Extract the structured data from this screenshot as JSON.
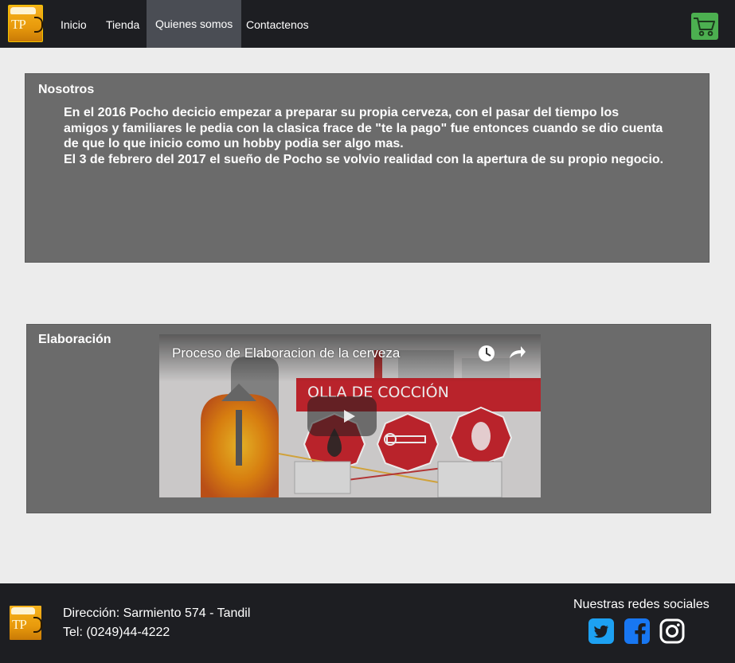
{
  "nav": {
    "logo_text": "TP",
    "items": [
      "Inicio",
      "Tienda",
      "Quienes somos",
      "Contactenos"
    ],
    "active": "Quienes somos",
    "cart_icon": "shopping-cart-icon"
  },
  "about": {
    "title": "Nosotros",
    "lines": [
      "En el 2016 Pocho decicio empezar a preparar su propia cerveza, con el pasar del tiempo los",
      "amigos y familiares le pedia con la clasica frace de \"te la pago\" fue entonces cuando se dio cuenta",
      "de que lo que inicio como un hobby podia ser algo mas.",
      "El 3 de febrero del 2017 el sueño de Pocho se volvio realidad con la apertura de su propio negocio."
    ]
  },
  "elaboration": {
    "title": "Elaboración",
    "video": {
      "title": "Proceso de Elaboracion de la cerveza",
      "banner": "OLLA DE COCCIÓN",
      "icons": [
        "watch-later-icon",
        "share-icon",
        "play-icon"
      ]
    }
  },
  "footer": {
    "logo_text": "TP",
    "address": "Dirección: Sarmiento 574 - Tandil",
    "phone": "Tel: (0249)44-4222",
    "social_title": "Nuestras redes sociales",
    "social_icons": [
      "twitter-icon",
      "facebook-icon",
      "instagram-icon"
    ]
  },
  "colors": {
    "navbar": "#1d1e22",
    "nav_active": "#4a4d54",
    "panel": "#6b6b6b",
    "page_bg": "#ececec",
    "cart": "#4caf50",
    "twitter": "#1da1f2",
    "facebook": "#1877f2"
  }
}
